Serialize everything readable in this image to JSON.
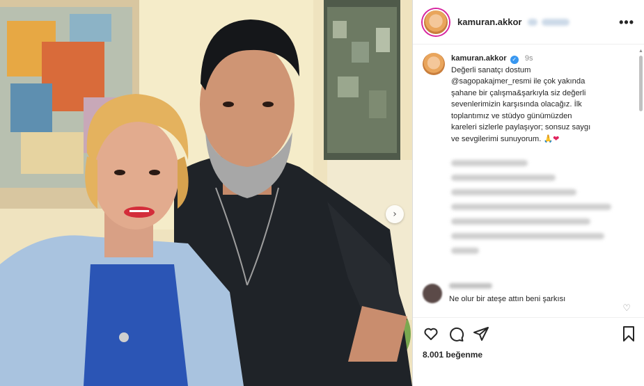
{
  "post": {
    "username": "kamuran.akkor",
    "time_ago": "9s",
    "caption_lines": [
      "Değerli sanatçı dostum",
      "@sagopakajmer_resmi ile çok yakında",
      "şahane bir çalışma&şarkıyla siz değerli",
      "sevenlerimizin karşısında olacağız. İlk",
      "toplantımız ve stüdyo günümüzden",
      "kareleri sizlerle paylaşıyor; sonsuz saygı",
      "ve sevgilerimi sunuyorum."
    ],
    "caption_emoji_pray": "🙏",
    "caption_emoji_heart": "❤",
    "comment_text": "Ne olur bir ateşe attın beni şarkısı",
    "likes": "8.001 beğenme",
    "menu_icon": "•••",
    "next_icon": "›"
  },
  "colors": {
    "verified": "#3897f0",
    "story_ring": "#d6249f",
    "heart": "#e0245e"
  },
  "icons": [
    "more-options-icon",
    "verified-icon",
    "heart-icon",
    "comment-icon",
    "share-icon",
    "bookmark-icon",
    "next-arrow-icon"
  ]
}
